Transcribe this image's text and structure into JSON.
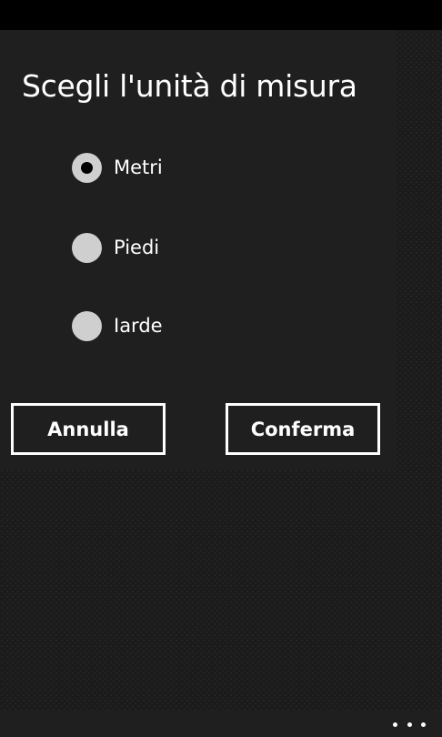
{
  "dialog": {
    "title": "Scegli l'unità di misura",
    "options": [
      {
        "label": "Metri",
        "selected": true
      },
      {
        "label": "Piedi",
        "selected": false
      },
      {
        "label": "Iarde",
        "selected": false
      }
    ],
    "cancel_label": "Annulla",
    "confirm_label": "Conferma"
  },
  "app_bar": {
    "more_icon": "ellipsis-icon"
  },
  "colors": {
    "dialog_background": "#1f1f1f",
    "radio_fill": "#cfcfcf",
    "text": "#ffffff"
  }
}
